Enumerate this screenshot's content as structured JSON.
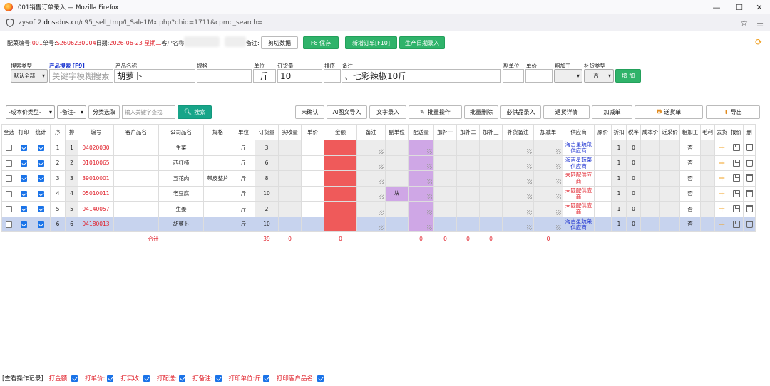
{
  "window": {
    "title": "001销售订单录入 — Mozilla Firefox",
    "url_prefix": "zysoft2.",
    "url_domain": "dns-dns.cn",
    "url_rest": "/c95_sell_tmp/I_Sale1Mx.php?dhid=1711&cpmc_search="
  },
  "header": {
    "ps_label": "配菜编号:",
    "ps_value": "001",
    "order_label": "单号:",
    "order_value": "S2606230004",
    "date_label": "日期:",
    "date_value": "2026-06-23 星期二",
    "customer_label": "客户名称",
    "remark_label": "备注:",
    "btn_cut": "剪切数据",
    "btn_save": "F8 保存",
    "btn_new": "新增订单[F10]",
    "btn_prod_date": "生产日期录入"
  },
  "entry": {
    "labels": {
      "search_type": "搜索类型",
      "product_search": "产品搜索 [F9]",
      "product_name": "产品名称",
      "spec": "规格",
      "unit": "单位",
      "order_qty": "订货量",
      "sort": "排序",
      "remark": "备注",
      "sub_unit": "副单位",
      "unit_price": "单价",
      "rough": "粗加工",
      "supp_type": "补货类型"
    },
    "search_type_value": "默认全部",
    "search_placeholder": "关键字模糊搜索",
    "product_name_value": "胡萝卜",
    "unit_value": "斤",
    "order_qty_value": "10",
    "remark_value": "、七彩辣椒10斤",
    "supp_type_value": "否",
    "add_button": "增 加"
  },
  "toolbar": {
    "cost_type": "-成本价类型-",
    "remark_sel": "-备注-",
    "category_pick": "分类选取",
    "keyword_placeholder": "输入关键字查找",
    "search_btn": "搜索",
    "unconfirmed": "未确认",
    "ai_import": "AI图文导入",
    "text_entry": "文字录入",
    "batch_op": "批量操作",
    "batch_delete": "批量删除",
    "required_supply": "必供品录入",
    "return_detail": "退货详情",
    "add_reduce": "加减单",
    "delivery": "送货单",
    "export": "导出"
  },
  "table": {
    "headers": [
      "全选",
      "打印",
      "统计",
      "序",
      "排",
      "编号",
      "客户品名",
      "公司品名",
      "规格",
      "单位",
      "订货量",
      "实收量",
      "单价",
      "金额",
      "备注",
      "副单位",
      "配送量",
      "加补一",
      "加补二",
      "加补三",
      "补货备注",
      "加减单",
      "供应商",
      "原价",
      "折扣",
      "税率",
      "成本价",
      "近采价",
      "粗加工",
      "毛利",
      "去货",
      "报价",
      "删"
    ],
    "rows": [
      {
        "seq": "1",
        "pai": "1",
        "code": "04020030",
        "name": "生菜",
        "spec": "",
        "unit": "斤",
        "qty": "3",
        "sub_unit": "",
        "supplier": "海吉星蔬菜供应商",
        "supplier_red": false,
        "discount": "1",
        "tax": "0",
        "rough": "否"
      },
      {
        "seq": "2",
        "pai": "2",
        "code": "01010065",
        "name": "西红柿",
        "spec": "",
        "unit": "斤",
        "qty": "6",
        "sub_unit": "",
        "supplier": "海吉星蔬菜供应商",
        "supplier_red": false,
        "discount": "1",
        "tax": "0",
        "rough": "否"
      },
      {
        "seq": "3",
        "pai": "3",
        "code": "39010001",
        "name": "五花肉",
        "spec": "带皮整片",
        "unit": "斤",
        "qty": "8",
        "sub_unit": "",
        "supplier": "未匹配供应商",
        "supplier_red": true,
        "discount": "1",
        "tax": "0",
        "rough": "否"
      },
      {
        "seq": "4",
        "pai": "4",
        "code": "05010011",
        "name": "老豆腐",
        "spec": "",
        "unit": "斤",
        "qty": "10",
        "sub_unit": "块",
        "supplier": "未匹配供应商",
        "supplier_red": true,
        "discount": "1",
        "tax": "0",
        "rough": "否"
      },
      {
        "seq": "5",
        "pai": "5",
        "code": "04140057",
        "name": "生姜",
        "spec": "",
        "unit": "斤",
        "qty": "2",
        "sub_unit": "",
        "supplier": "未匹配供应商",
        "supplier_red": true,
        "discount": "1",
        "tax": "0",
        "rough": "否"
      },
      {
        "seq": "6",
        "pai": "6",
        "code": "04180013",
        "name": "胡萝卜",
        "spec": "",
        "unit": "斤",
        "qty": "10",
        "sub_unit": "",
        "supplier": "海吉星蔬菜供应商",
        "supplier_red": false,
        "discount": "1",
        "tax": "0",
        "rough": "否"
      }
    ],
    "total": {
      "label": "合计",
      "qty": "39",
      "recv": "0",
      "amount": "0",
      "delivery": "0",
      "add1": "0",
      "add2": "0",
      "add3": "0",
      "addsub": "0"
    }
  },
  "footer": {
    "log": "[查看操作记录]",
    "items": [
      "打金额:",
      "打单价:",
      "打实收:",
      "打配送:",
      "打备注:",
      "打印单位:斤",
      "打印客户品名:"
    ]
  }
}
